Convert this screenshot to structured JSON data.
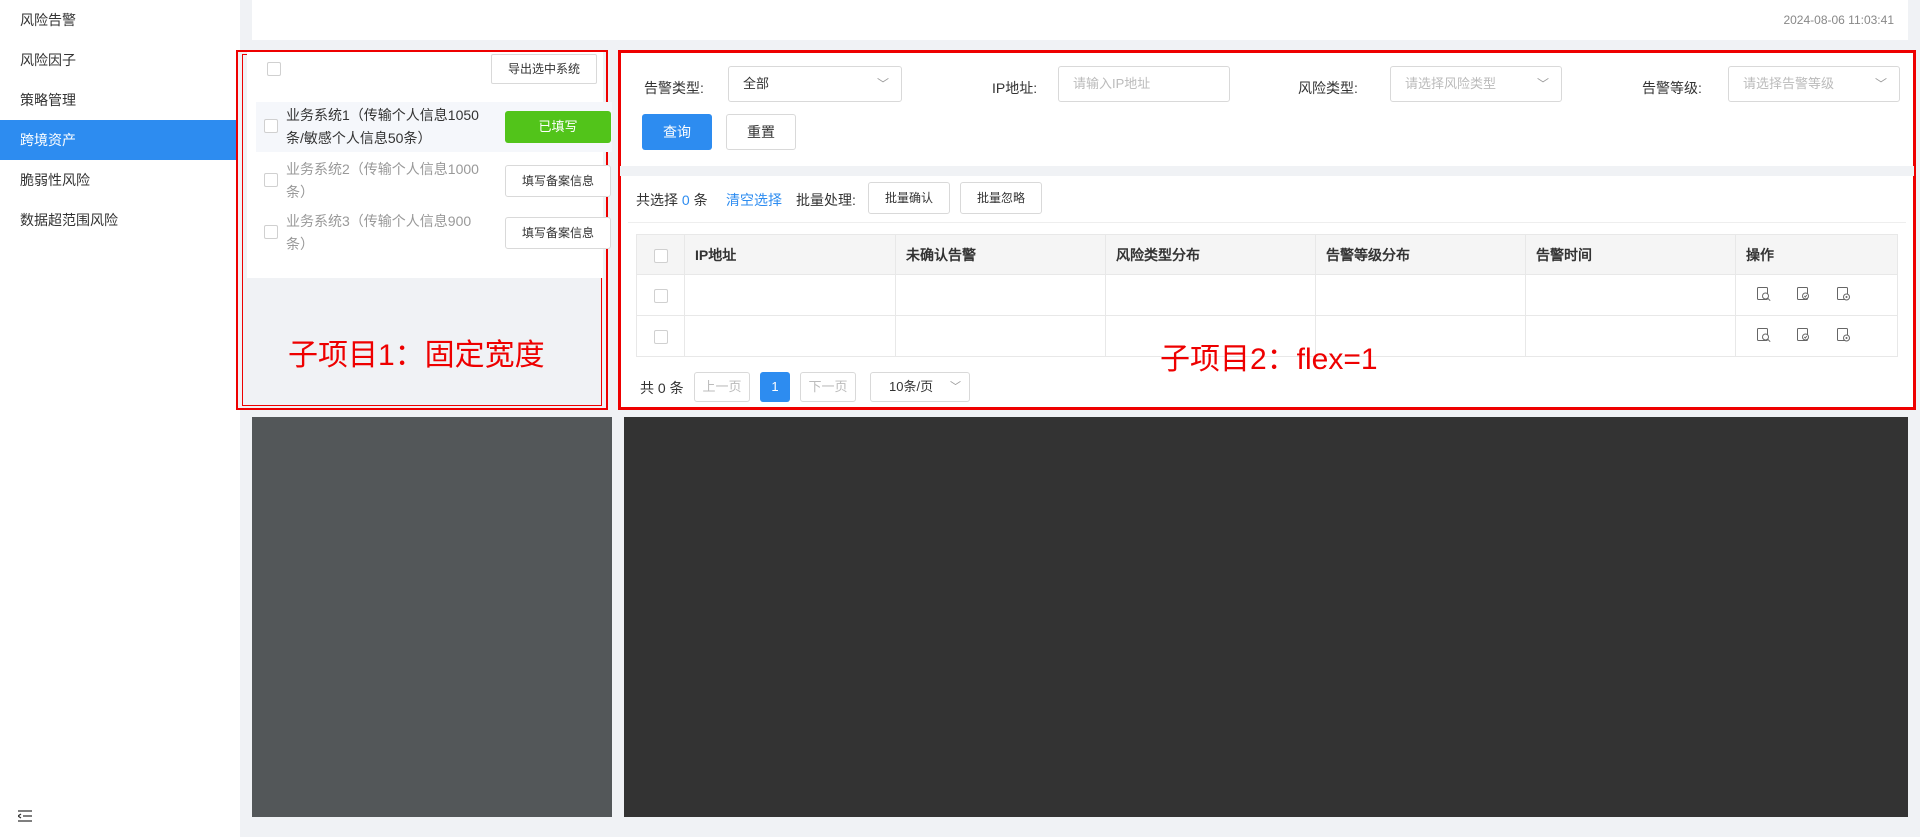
{
  "sidebar": {
    "items": [
      {
        "label": "风险告警",
        "active": false
      },
      {
        "label": "风险因子",
        "active": false
      },
      {
        "label": "策略管理",
        "active": false
      },
      {
        "label": "跨境资产",
        "active": true
      },
      {
        "label": "脆弱性风险",
        "active": false
      },
      {
        "label": "数据超范围风险",
        "active": false
      }
    ],
    "collapse_icon": "menu-collapse-icon"
  },
  "header": {
    "timestamp": "2024-08-06 11:03:41"
  },
  "left_panel": {
    "export_label": "导出选中系统",
    "systems": [
      {
        "name": "业务系统1（传输个人信息1050条/敏感个人信息50条）",
        "action": "已填写",
        "filled": true
      },
      {
        "name": "业务系统2（传输个人信息1000条）",
        "action": "填写备案信息",
        "filled": false
      },
      {
        "name": "业务系统3（传输个人信息900条）",
        "action": "填写备案信息",
        "filled": false
      }
    ],
    "annotation": "子项目1：固定宽度"
  },
  "right_panel": {
    "filters": {
      "alert_type_label": "告警类型:",
      "alert_type_value": "全部",
      "ip_label": "IP地址:",
      "ip_placeholder": "请输入IP地址",
      "risk_type_label": "风险类型:",
      "risk_type_placeholder": "请选择风险类型",
      "alert_level_label": "告警等级:",
      "alert_level_placeholder": "请选择告警等级",
      "query_label": "查询",
      "reset_label": "重置"
    },
    "batch": {
      "selected_prefix": "共选择",
      "selected_count": "0",
      "selected_suffix": "条",
      "clear_label": "清空选择",
      "batch_label": "批量处理:",
      "confirm_label": "批量确认",
      "ignore_label": "批量忽略"
    },
    "table": {
      "columns": [
        "IP地址",
        "未确认告警",
        "风险类型分布",
        "告警等级分布",
        "告警时间",
        "操作"
      ],
      "row_count": 2,
      "op_icons": [
        "view-detail-icon",
        "search-doc-icon",
        "settings-doc-icon"
      ]
    },
    "pagination": {
      "total": "共 0 条",
      "prev_label": "上一页",
      "current_page": "1",
      "next_label": "下一页",
      "page_size": "10条/页"
    },
    "annotation": "子项目2：flex=1"
  },
  "colors": {
    "primary": "#2d8cf0",
    "success": "#52c41a",
    "annotation": "#e00000",
    "placeholder_left": "#535759",
    "placeholder_right": "#333333"
  }
}
